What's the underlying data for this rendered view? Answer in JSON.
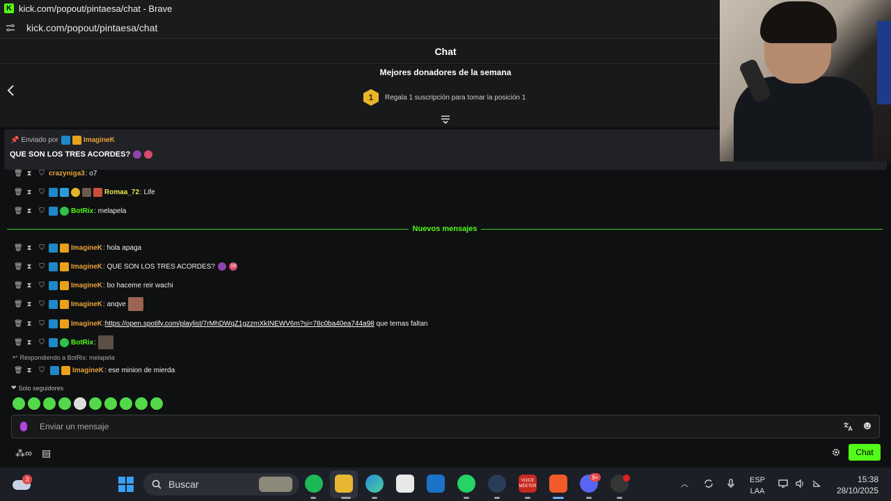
{
  "window": {
    "title": "kick.com/popout/pintaesa/chat - Brave",
    "url": "kick.com/popout/pintaesa/chat"
  },
  "chat": {
    "header": "Chat",
    "leaderboard": {
      "title": "Mejores donadores de la semana",
      "rank": "1",
      "prompt": "Regala 1 suscripción para tomar la posición 1"
    },
    "pinned": {
      "label": "Enviado por",
      "user": "ImagineK",
      "text": "QUE SON LOS TRES ACORDES?"
    },
    "messages": [
      {
        "user": "crazyniga3",
        "text": ": o7"
      },
      {
        "user": "Romaa_72",
        "text": ": Life"
      },
      {
        "user": "BotRix",
        "text": ": melapela"
      },
      {
        "user": "ImagineK",
        "text": ": hola apaga"
      },
      {
        "user": "ImagineK",
        "text": ": QUE SON LOS TRES ACORDES?"
      },
      {
        "user": "ImagineK",
        "text": ": bo haceme reir wachi"
      },
      {
        "user": "ImagineK",
        "text": ": anqve"
      },
      {
        "user": "ImagineK",
        "text": ": ",
        "link": "https://open.spotify.com/playlist/7rMhDWqZ1gzzmXkINEWV6m?si=78c0ba40ea744a98",
        "after": " que temas faltan"
      },
      {
        "user": "BotRix",
        "text": ":"
      },
      {
        "user": "ImagineK",
        "text": ": ese minion de mierda"
      }
    ],
    "new_messages_label": "Nuevos mensajes",
    "reply_label": "Respondiendo a BotRix: melapela",
    "followers_only": "Solo seguidores",
    "input_placeholder": "Enviar un mensaje",
    "chat_button": "Chat",
    "badge_18": "18"
  },
  "taskbar": {
    "weather_badge": "3",
    "search_placeholder": "Buscar",
    "discord_badge": "9+",
    "voice_label": "VOICE MEETER",
    "lang_top": "ESP",
    "lang_bottom": "LAA",
    "time": "15:38",
    "date": "28/10/2025"
  },
  "colors": {
    "kick_green": "#53fc18",
    "sub_orange": "#e8a23a"
  },
  "icons": [
    "back-icon",
    "expand-icon",
    "pin-icon",
    "trash-icon",
    "hourglass-icon",
    "shield-icon",
    "mic-icon",
    "translate-icon",
    "smile-icon",
    "gear-icon",
    "windows-icon",
    "search-icon"
  ]
}
